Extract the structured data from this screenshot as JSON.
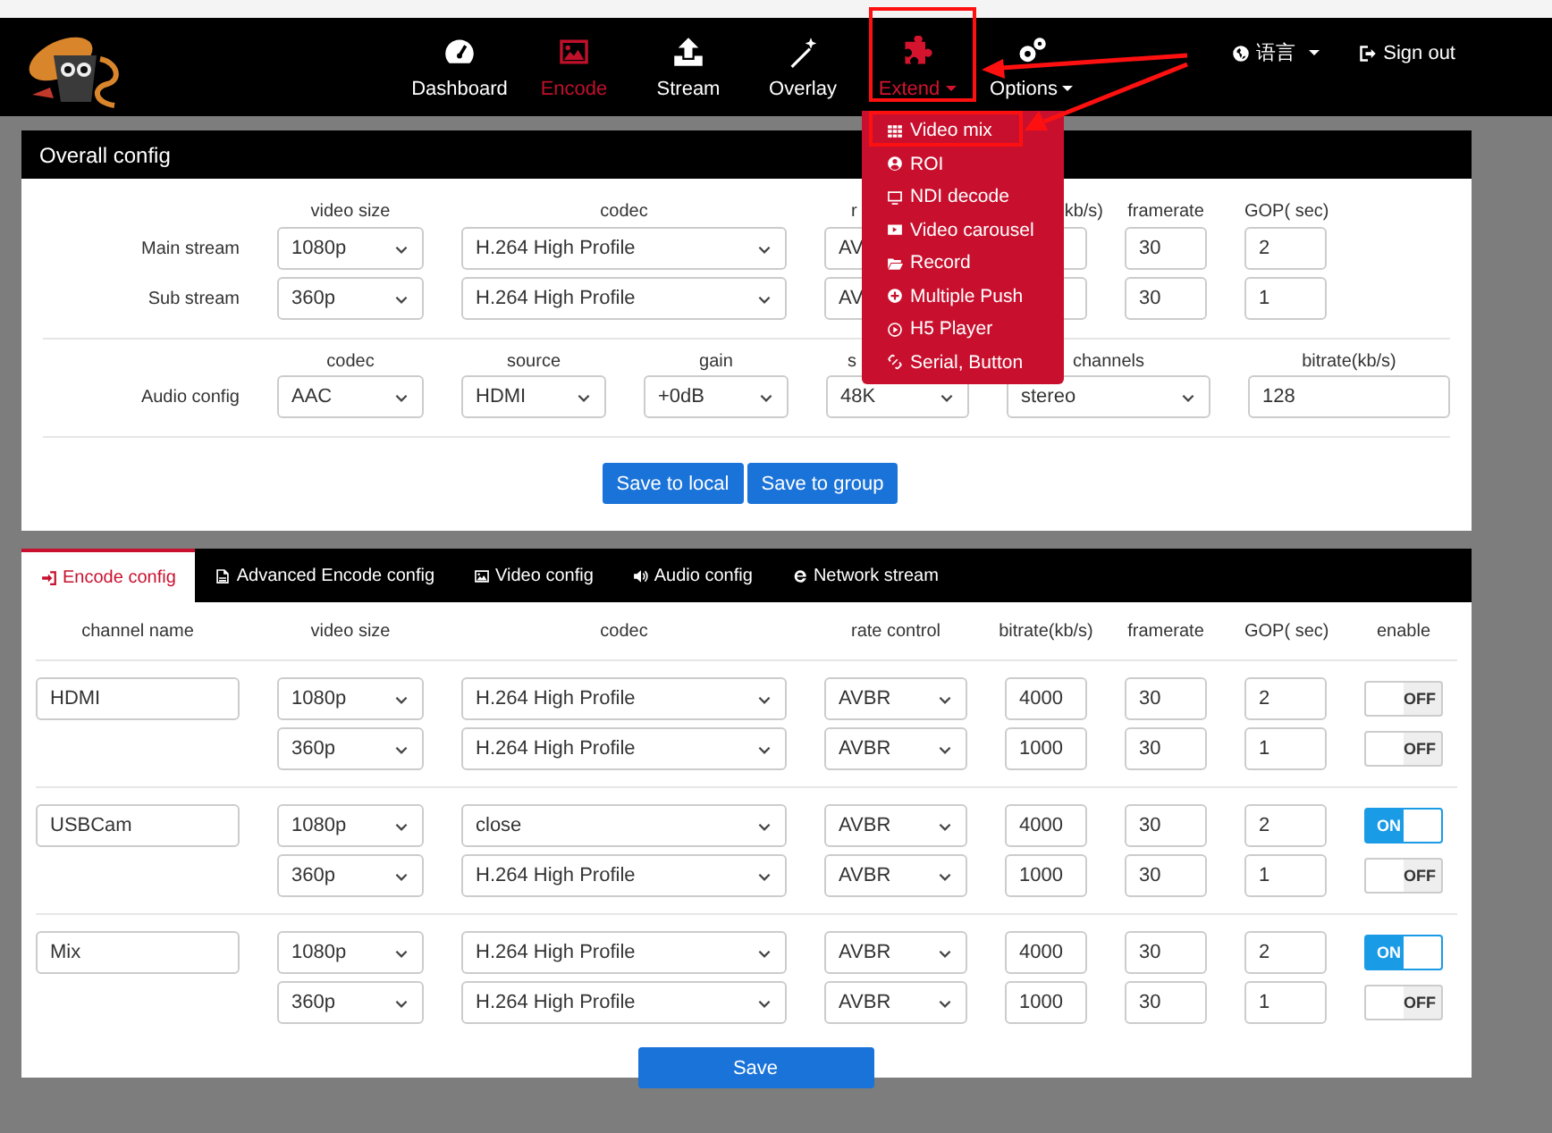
{
  "nav": {
    "items": [
      {
        "label": "Dashboard",
        "selected": false,
        "open": false,
        "dropdown": false
      },
      {
        "label": "Encode",
        "selected": true,
        "open": false,
        "dropdown": false
      },
      {
        "label": "Stream",
        "selected": false,
        "open": false,
        "dropdown": false
      },
      {
        "label": "Overlay",
        "selected": false,
        "open": false,
        "dropdown": false
      },
      {
        "label": "Extend",
        "selected": false,
        "open": true,
        "dropdown": true
      },
      {
        "label": "Options",
        "selected": false,
        "open": false,
        "dropdown": true
      }
    ],
    "language": "语言",
    "sign_out": "Sign out"
  },
  "extend_menu": {
    "items": [
      {
        "label": "Video mix"
      },
      {
        "label": "ROI"
      },
      {
        "label": "NDI decode"
      },
      {
        "label": "Video carousel"
      },
      {
        "label": "Record"
      },
      {
        "label": "Multiple Push"
      },
      {
        "label": "H5 Player"
      },
      {
        "label": "Serial, Button"
      }
    ]
  },
  "overall": {
    "title": "Overall config",
    "video_columns": [
      "video size",
      "codec",
      "r",
      "kb/s)",
      "framerate",
      "GOP( sec)"
    ],
    "video_rows": [
      {
        "label": "Main stream",
        "video_size": "1080p",
        "codec": "H.264 High Profile",
        "rate_control": "AV",
        "framerate": "30",
        "gop": "2"
      },
      {
        "label": "Sub stream",
        "video_size": "360p",
        "codec": "H.264 High Profile",
        "rate_control": "AV",
        "framerate": "30",
        "gop": "1"
      }
    ],
    "audio_columns": [
      "codec",
      "source",
      "gain",
      "s",
      "channels",
      "bitrate(kb/s)"
    ],
    "audio_row": {
      "label": "Audio config",
      "codec": "AAC",
      "source": "HDMI",
      "gain": "+0dB",
      "samplerate": "48K",
      "channels": "stereo",
      "bitrate": "128"
    },
    "buttons": [
      "Save to local",
      "Save to group"
    ]
  },
  "encode": {
    "tabs": [
      {
        "label": "Encode config",
        "selected": true
      },
      {
        "label": "Advanced Encode config",
        "selected": false
      },
      {
        "label": "Video config",
        "selected": false
      },
      {
        "label": "Audio config",
        "selected": false
      },
      {
        "label": "Network stream",
        "selected": false
      }
    ],
    "columns": [
      "channel name",
      "video size",
      "codec",
      "rate control",
      "bitrate(kb/s)",
      "framerate",
      "GOP( sec)",
      "enable"
    ],
    "channels": [
      {
        "name": "HDMI",
        "streams": [
          {
            "video_size": "1080p",
            "codec": "H.264 High Profile",
            "rate_control": "AVBR",
            "bitrate": "4000",
            "framerate": "30",
            "gop": "2",
            "enabled": false,
            "toggle_label": "OFF"
          },
          {
            "video_size": "360p",
            "codec": "H.264 High Profile",
            "rate_control": "AVBR",
            "bitrate": "1000",
            "framerate": "30",
            "gop": "1",
            "enabled": false,
            "toggle_label": "OFF"
          }
        ]
      },
      {
        "name": "USBCam",
        "streams": [
          {
            "video_size": "1080p",
            "codec": "close",
            "rate_control": "AVBR",
            "bitrate": "4000",
            "framerate": "30",
            "gop": "2",
            "enabled": true,
            "toggle_label": "ON"
          },
          {
            "video_size": "360p",
            "codec": "H.264 High Profile",
            "rate_control": "AVBR",
            "bitrate": "1000",
            "framerate": "30",
            "gop": "1",
            "enabled": false,
            "toggle_label": "OFF"
          }
        ]
      },
      {
        "name": "Mix",
        "streams": [
          {
            "video_size": "1080p",
            "codec": "H.264 High Profile",
            "rate_control": "AVBR",
            "bitrate": "4000",
            "framerate": "30",
            "gop": "2",
            "enabled": true,
            "toggle_label": "ON"
          },
          {
            "video_size": "360p",
            "codec": "H.264 High Profile",
            "rate_control": "AVBR",
            "bitrate": "1000",
            "framerate": "30",
            "gop": "1",
            "enabled": false,
            "toggle_label": "OFF"
          }
        ]
      }
    ],
    "save_button": "Save"
  }
}
